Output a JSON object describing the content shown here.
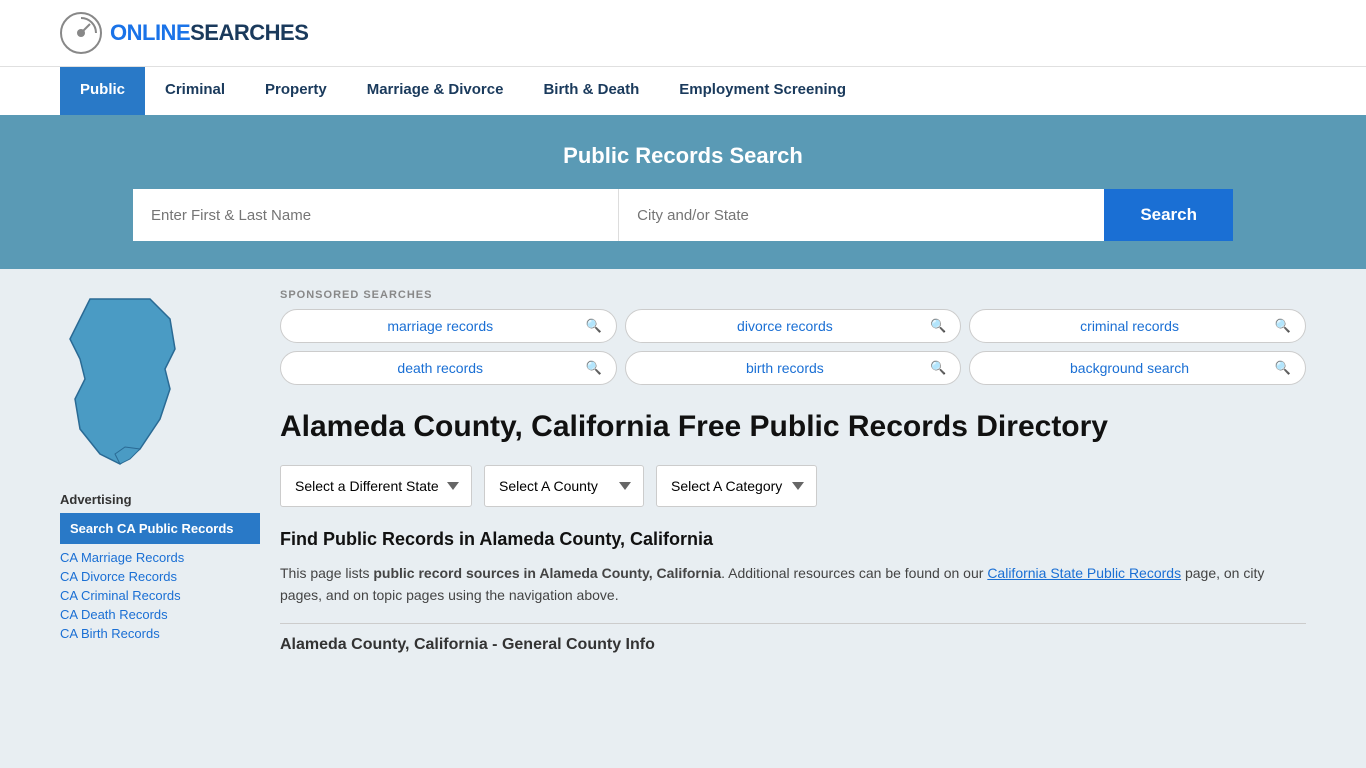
{
  "header": {
    "logo_text_part1": "ONLINE",
    "logo_text_part2": "SEARCHES"
  },
  "nav": {
    "items": [
      {
        "label": "Public",
        "active": true
      },
      {
        "label": "Criminal",
        "active": false
      },
      {
        "label": "Property",
        "active": false
      },
      {
        "label": "Marriage & Divorce",
        "active": false
      },
      {
        "label": "Birth & Death",
        "active": false
      },
      {
        "label": "Employment Screening",
        "active": false
      }
    ]
  },
  "search_banner": {
    "title": "Public Records Search",
    "name_placeholder": "Enter First & Last Name",
    "location_placeholder": "City and/or State",
    "button_label": "Search"
  },
  "sponsored": {
    "label": "SPONSORED SEARCHES",
    "tags": [
      {
        "text": "marriage records"
      },
      {
        "text": "divorce records"
      },
      {
        "text": "criminal records"
      },
      {
        "text": "death records"
      },
      {
        "text": "birth records"
      },
      {
        "text": "background search"
      }
    ]
  },
  "page": {
    "heading": "Alameda County, California Free Public Records Directory",
    "dropdowns": {
      "state": "Select a Different State",
      "county": "Select A County",
      "category": "Select A Category"
    },
    "find_title": "Find Public Records in Alameda County, California",
    "find_text_part1": "This page lists ",
    "find_text_bold": "public record sources in Alameda County, California",
    "find_text_part2": ". Additional resources can be found on our ",
    "find_link_text": "California State Public Records",
    "find_text_part3": " page, on city pages, and on topic pages using the navigation above.",
    "county_info_heading": "Alameda County, California - General County Info"
  },
  "sidebar": {
    "advertising_label": "Advertising",
    "ad_box_text": "Search CA Public Records",
    "links": [
      "CA Marriage Records",
      "CA Divorce Records",
      "CA Criminal Records",
      "CA Death Records",
      "CA Birth Records"
    ]
  }
}
